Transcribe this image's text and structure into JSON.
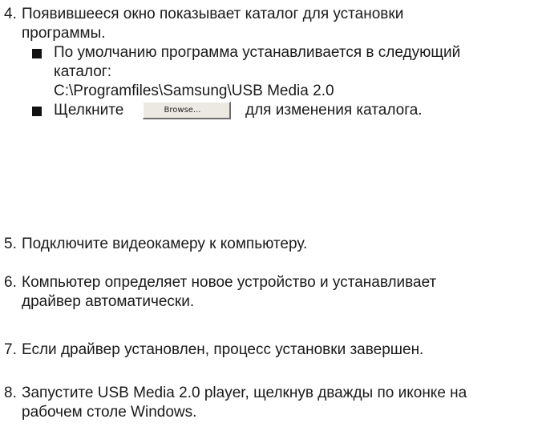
{
  "step4": {
    "number": "4.",
    "line1": "Появившееся окно показывает каталог для установки",
    "line2": "программы.",
    "bullet1": {
      "line1": "По умолчанию программа устанавливается в следующий",
      "line2": "каталог:",
      "line3": "C:\\Programfiles\\Samsung\\USB Media 2.0"
    },
    "bullet2": {
      "before": "Щелкните",
      "button_label": "Browse...",
      "after": "для изменения каталога."
    }
  },
  "step5": {
    "number": "5.",
    "line1": "Подключите видеокамеру к компьютеру."
  },
  "step6": {
    "number": "6.",
    "line1": "Компьютер определяет новое устройство и устанавливает",
    "line2": "драйвер автоматически."
  },
  "step7": {
    "number": "7.",
    "line1": "Если драйвер установлен, процесс установки завершен."
  },
  "step8": {
    "number": "8.",
    "line1": "Запустите USB Media 2.0 player, щелкнув дважды по иконке на",
    "line2": "рабочем столе Windows."
  }
}
